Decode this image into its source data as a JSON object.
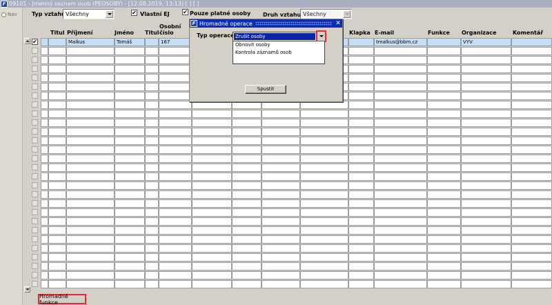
{
  "window": {
    "title": "09101 - Jmenný seznam osob (PEOSOBY) - [12.08.2019, 13:13]  [ ]  [ ]",
    "logo": "F"
  },
  "nav": {
    "label": "Nav",
    "icon": "nav-icon"
  },
  "filters": {
    "relation_type_label": "Typ vztahu",
    "relation_type_value": "Všechny",
    "own_ej_label": "Vlastní EJ",
    "own_ej_checked": "✔",
    "valid_only_label": "Pouze platné osoby",
    "valid_only_checked": "✔",
    "relation_kind_label": "Druh vztahu",
    "relation_kind_value": "Všechny"
  },
  "table": {
    "columns": {
      "titul": "Titul",
      "prijmeni": "Příjmení",
      "jmeno": "Jméno",
      "titul2": "Titul",
      "osobni_cislo_1": "Osobní",
      "osobni_cislo_2": "číslo",
      "klapka": "Klapka",
      "email": "E-mail",
      "funkce": "Funkce",
      "organizace": "Organizace",
      "komentar": "Komentář"
    },
    "first_row": {
      "checked": "✔",
      "prijmeni": "Malkus",
      "jmeno": "Tomáš",
      "osobni_cislo": "167",
      "email": "tmalkus@bbm.cz",
      "organizace": "VYV"
    }
  },
  "bulk_button": {
    "label": "Hromadné funkce"
  },
  "dialog": {
    "logo": "F",
    "title": "Hromadné operace",
    "close": "✕",
    "field_label": "Typ operace",
    "selected": "Zrušit osoby",
    "options": [
      "Obnovit osoby",
      "Kontrola záznamů osob"
    ],
    "run_button": "Spustit"
  },
  "colors": {
    "titlebar_active": "#0f2db4",
    "selection": "#0a24a6",
    "highlight": "#e8262b",
    "selected_row": "#c8def6"
  }
}
